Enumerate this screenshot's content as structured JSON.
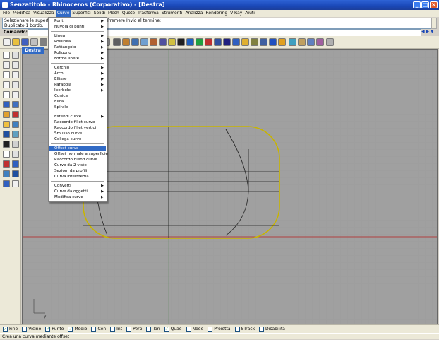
{
  "window": {
    "title": "Senzatitolo - Rhinoceros (Corporativo) - [Destra]",
    "buttons": [
      "_",
      "□",
      "×"
    ]
  },
  "menubar": [
    "File",
    "Modifica",
    "Visualizza",
    "Curve",
    "Superfici",
    "Solidi",
    "Mesh",
    "Quote",
    "Trasforma",
    "Strumenti",
    "Analizza",
    "Rendering",
    "V-Ray",
    "Aiuti"
  ],
  "active_menu": "Curve",
  "command_history": [
    "Selezionare le superfici",
    "Duplicato 1 bordo."
  ],
  "command_history_right": "Premere Invio al termine:",
  "command_label": "Comando:",
  "viewport_tab": "Destra",
  "axis_label_y": "y",
  "curve_menu": [
    {
      "label": "Punti",
      "submenu": true
    },
    {
      "label": "Nuvola di punti",
      "submenu": true
    },
    {
      "sep": true
    },
    {
      "label": "Linea",
      "submenu": true
    },
    {
      "label": "Polilinea",
      "submenu": true
    },
    {
      "label": "Rettangolo",
      "submenu": true
    },
    {
      "label": "Poligono",
      "submenu": true
    },
    {
      "label": "Forme libere",
      "submenu": true
    },
    {
      "sep": true
    },
    {
      "label": "Cerchio",
      "submenu": true
    },
    {
      "label": "Arco",
      "submenu": true
    },
    {
      "label": "Ellisse",
      "submenu": true
    },
    {
      "label": "Parabola",
      "submenu": true
    },
    {
      "label": "Iperbole",
      "submenu": true
    },
    {
      "label": "Conica",
      "submenu": false
    },
    {
      "label": "Elica",
      "submenu": false
    },
    {
      "label": "Spirale",
      "submenu": false
    },
    {
      "sep": true
    },
    {
      "label": "Estendi curve",
      "submenu": true
    },
    {
      "label": "Raccordo fillet curve",
      "submenu": false
    },
    {
      "label": "Raccordo fillet vertici",
      "submenu": false
    },
    {
      "label": "Smusso curve",
      "submenu": false
    },
    {
      "label": "Collega curve",
      "submenu": false
    },
    {
      "sep": true
    },
    {
      "label": "Offset curve",
      "submenu": false,
      "highlight": true
    },
    {
      "label": "Offset normale a superficie",
      "submenu": false
    },
    {
      "label": "Raccordo blend curve",
      "submenu": false
    },
    {
      "label": "Curve da 2 viste",
      "submenu": false
    },
    {
      "label": "Sezioni da profili",
      "submenu": false
    },
    {
      "label": "Curva intermedia",
      "submenu": false
    },
    {
      "sep": true
    },
    {
      "label": "Converti",
      "submenu": true
    },
    {
      "label": "Curve da oggetti",
      "submenu": true
    },
    {
      "label": "Modifica curve",
      "submenu": true
    }
  ],
  "osnaps": [
    {
      "label": "Fine",
      "checked": true
    },
    {
      "label": "Vicino",
      "checked": false
    },
    {
      "label": "Punto",
      "checked": true
    },
    {
      "label": "Medio",
      "checked": true
    },
    {
      "label": "Cen",
      "checked": false
    },
    {
      "label": "Int",
      "checked": false
    },
    {
      "label": "Perp",
      "checked": false
    },
    {
      "label": "Tan",
      "checked": false
    },
    {
      "label": "Quad",
      "checked": true
    },
    {
      "label": "Nodo",
      "checked": false
    },
    {
      "label": "Proietta",
      "checked": false
    },
    {
      "label": "STrack",
      "checked": false
    },
    {
      "label": "Disabilita",
      "checked": false
    }
  ],
  "status_text": "Crea una curva mediante offset",
  "colors": {
    "title": "#1a48b8",
    "highlight": "#316ac5",
    "viewport": "#a0a0a0",
    "outline": "#c8b400",
    "axis_red": "#b04040"
  }
}
